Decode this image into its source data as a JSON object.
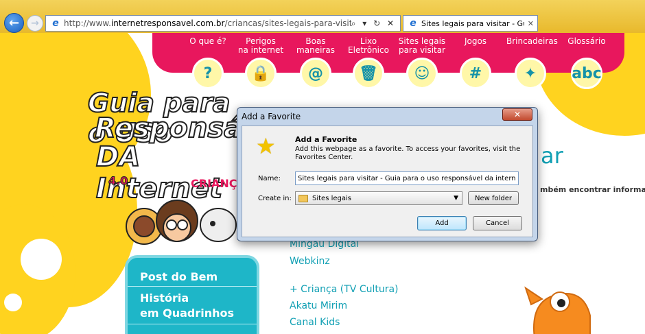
{
  "browser": {
    "url_prefix": "http://www.",
    "url_domain": "internetresponsavel.com.br",
    "url_path": "/criancas/sites-legais-para-visitar.php",
    "address_tools": "⌕ ▾ ↻ ✕",
    "tab_title": "Sites legais para visitar - Gui...",
    "tab_close": "✕"
  },
  "menu": {
    "items": [
      {
        "label": "O que é?",
        "icon": "?"
      },
      {
        "label": "Perigos\nna internet",
        "icon": "🔒"
      },
      {
        "label": "Boas\nmaneiras",
        "icon": "@"
      },
      {
        "label": "Lixo\nEletrônico",
        "icon": "🗑"
      },
      {
        "label": "Sites legais\npara visitar",
        "icon": "☺"
      },
      {
        "label": "Jogos",
        "icon": "#"
      },
      {
        "label": "Brincadeiras",
        "icon": "✦"
      },
      {
        "label": "Glossário",
        "icon": "abc"
      }
    ]
  },
  "logo": {
    "line1": "Guia para o USo",
    "line2": "Responsável",
    "line3": "DA Internet",
    "version": "4.0",
    "subtitle": "CRIANÇA"
  },
  "page": {
    "heading_tail": "ar",
    "intro_tail": "mbém encontrar informaçõe"
  },
  "sidebar": {
    "item1": "Post do Bem",
    "item2_line1": "História",
    "item2_line2": "em Quadrinhos"
  },
  "links": [
    "Mingau Digital",
    "Webkinz",
    "+ Criança (TV Cultura)",
    "Akatu Mirim",
    "Canal Kids"
  ],
  "dialog": {
    "title": "Add a Favorite",
    "close": "✕",
    "heading": "Add a Favorite",
    "description": "Add this webpage as a favorite. To access your favorites, visit the Favorites Center.",
    "name_label": "Name:",
    "name_value": "Sites legais para visitar - Guia para o uso responsável da internet - Cr",
    "create_label": "Create in:",
    "create_value": "Sites legais",
    "new_folder": "New folder",
    "add": "Add",
    "cancel": "Cancel"
  },
  "colors": {
    "menu_pink": "#e8175d",
    "page_yellow": "#ffd31f",
    "teal": "#12a0b4"
  }
}
